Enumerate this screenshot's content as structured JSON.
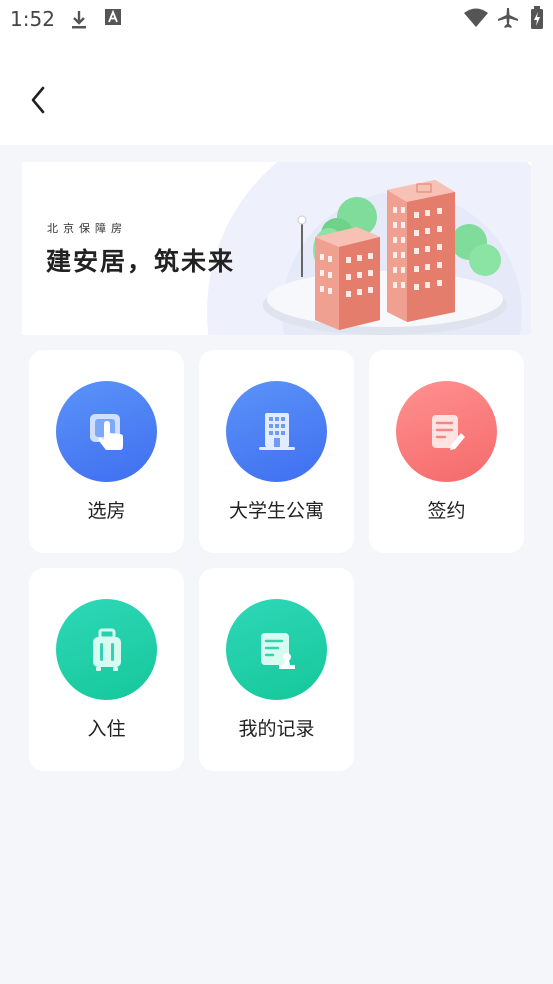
{
  "status_bar": {
    "time": "1:52",
    "icons": [
      "download-icon",
      "font-a-icon",
      "wifi-icon",
      "airplane-icon",
      "battery-charging-icon"
    ]
  },
  "nav": {
    "back_icon": "chevron-left-icon"
  },
  "banner": {
    "subtitle": "北京保障房",
    "title": "建安居，筑未来"
  },
  "menu": {
    "items": [
      {
        "label": "选房",
        "icon": "touch-select-icon",
        "color": "#4a7ff5"
      },
      {
        "label": "大学生公寓",
        "icon": "building-icon",
        "color": "#4a7ff5"
      },
      {
        "label": "签约",
        "icon": "contract-pen-icon",
        "color": "#f77c7c"
      },
      {
        "label": "入住",
        "icon": "luggage-icon",
        "color": "#1dcfa8"
      },
      {
        "label": "我的记录",
        "icon": "record-stamp-icon",
        "color": "#1dcfa8"
      }
    ]
  },
  "colors": {
    "background": "#f5f6fa",
    "card": "#ffffff",
    "text": "#222222"
  }
}
